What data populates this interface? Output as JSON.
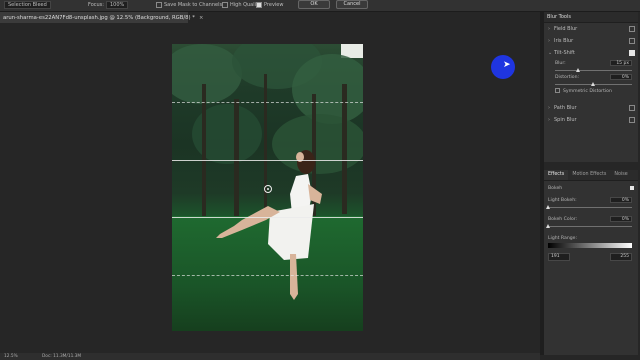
{
  "options_bar": {
    "items": [
      {
        "label": "Selection Bleed",
        "kind": "field"
      },
      {
        "label": "Focus:",
        "value": "100%",
        "kind": "field"
      },
      {
        "label": "Save Mask to Channels",
        "kind": "checkbox"
      },
      {
        "label": "High Quality",
        "kind": "checkbox"
      },
      {
        "label": "Preview",
        "kind": "checkbox"
      }
    ],
    "ok_label": "OK",
    "cancel_label": "Cancel"
  },
  "document": {
    "tab_title": "arun-sharma-es22AN7Fd8-unsplash.jpg @ 12.5% (Background, RGB/8) *",
    "close_glyph": "×"
  },
  "blur_tools": {
    "title": "Blur Tools",
    "items": [
      {
        "label": "Field Blur",
        "checked": false
      },
      {
        "label": "Iris Blur",
        "checked": false
      },
      {
        "label": "Tilt-Shift",
        "checked": true
      }
    ],
    "blur": {
      "label": "Blur:",
      "value": "15 px",
      "fraction": 0.3
    },
    "distortion": {
      "label": "Distortion:",
      "value": "0%",
      "fraction": 0.5
    },
    "symmetric": {
      "label": "Symmetric Distortion",
      "checked": false
    },
    "more_items": [
      {
        "label": "Path Blur",
        "checked": false
      },
      {
        "label": "Spin Blur",
        "checked": false
      }
    ]
  },
  "effects_panel": {
    "tabs": [
      {
        "label": "Effects",
        "active": true
      },
      {
        "label": "Motion Effects",
        "active": false
      },
      {
        "label": "Noise",
        "active": false
      }
    ],
    "bokeh": {
      "label": "Bokeh",
      "checked": true
    },
    "light_bokeh": {
      "label": "Light Bokeh:",
      "value": "0%",
      "fraction": 0.0
    },
    "bokeh_color": {
      "label": "Bokeh Color:",
      "value": "0%",
      "fraction": 0.0
    },
    "light_range": {
      "label": "Light Range:",
      "low": "191",
      "high": "255"
    }
  },
  "status": {
    "zoom": "12.5%",
    "doc": "Doc: 11.3M/11.3M"
  },
  "colors": {
    "accent_cursor": "#1f35e0",
    "panel_bg": "#323232",
    "canvas_bg": "#262626"
  }
}
